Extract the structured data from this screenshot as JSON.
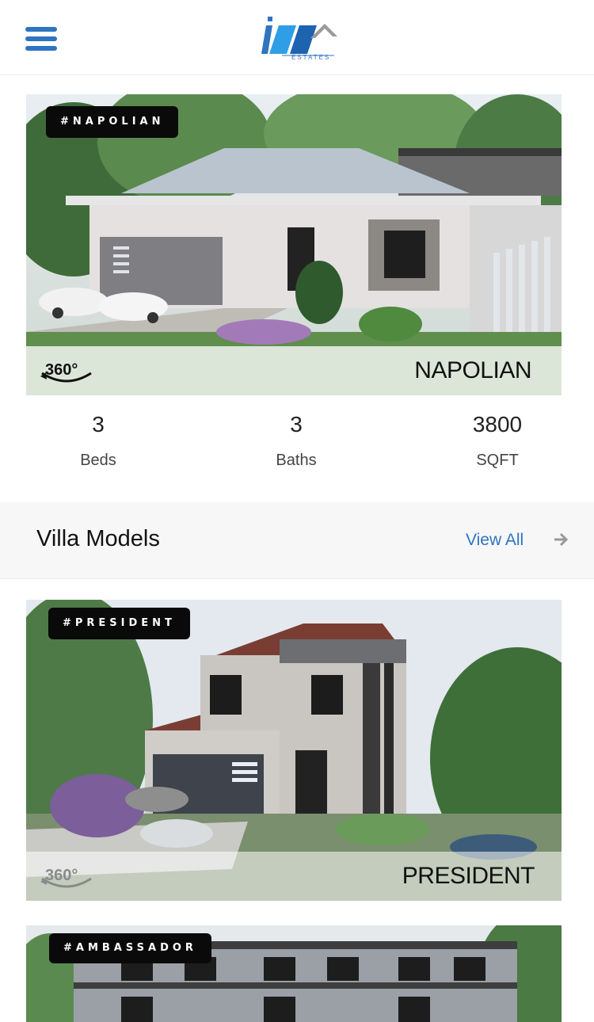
{
  "header": {
    "menu_icon": "hamburger-menu-icon",
    "logo_text": "ESTATES",
    "brand_color": "#2f74c0"
  },
  "featured": {
    "tag": "#NAPOLIAN",
    "name": "NAPOLIAN",
    "badge_icon": "360-view-icon",
    "badge_text": "360°"
  },
  "stats": [
    {
      "value": "3",
      "label": "Beds"
    },
    {
      "value": "3",
      "label": "Baths"
    },
    {
      "value": "3800",
      "label": "SQFT"
    }
  ],
  "section": {
    "title": "Villa Models",
    "view_all": "View All",
    "arrow_icon": "arrow-right-icon"
  },
  "villas": [
    {
      "tag": "#PRESIDENT",
      "name": "PRESIDENT",
      "badge_text": "360°"
    },
    {
      "tag": "#AMBASSADOR",
      "name": "",
      "badge_text": ""
    }
  ]
}
